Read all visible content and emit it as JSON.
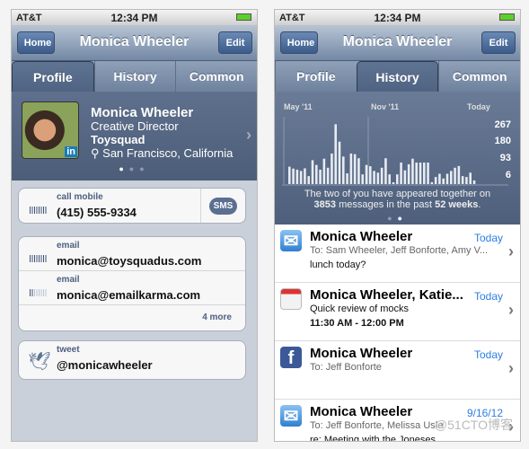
{
  "status": {
    "carrier": "AT&T",
    "time": "12:34 PM"
  },
  "nav": {
    "back": "Home",
    "title": "Monica Wheeler",
    "edit": "Edit"
  },
  "tabs": [
    "Profile",
    "History",
    "Common"
  ],
  "profile": {
    "name": "Monica Wheeler",
    "title": "Creative Director",
    "company": "Toysquad",
    "location": "San Francisco, California",
    "badge": "in"
  },
  "contacts": {
    "phone": {
      "label": "call mobile",
      "value": "(415) 555-9334",
      "sms": "SMS"
    },
    "emails": [
      {
        "label": "email",
        "value": "monica@toysquadus.com"
      },
      {
        "label": "email",
        "value": "monica@emailkarma.com"
      }
    ],
    "more": "4 more",
    "tweet": {
      "label": "tweet",
      "value": "@monicawheeler"
    }
  },
  "chart_data": {
    "type": "bar",
    "x_labels": [
      "May '11",
      "Nov '11",
      "Today"
    ],
    "y_ticks": [
      267,
      180,
      93,
      6
    ],
    "values": [
      81,
      72,
      67,
      61,
      73,
      37,
      111,
      89,
      67,
      118,
      76,
      142,
      278,
      197,
      128,
      50,
      142,
      139,
      120,
      45,
      89,
      83,
      61,
      53,
      76,
      120,
      45,
      6,
      45,
      100,
      64,
      92,
      118,
      100,
      100,
      100,
      100,
      9,
      33,
      48,
      26,
      48,
      61,
      76,
      84,
      37,
      33,
      53,
      17
    ]
  },
  "history": {
    "msg_pre": "The two of you have appeared together on",
    "count": "3853",
    "msg_mid": "messages in the past",
    "period": "52 weeks",
    "msg_end": "."
  },
  "messages": [
    {
      "icon": "mail",
      "title": "Monica Wheeler",
      "date": "Today",
      "line1": "To: Sam Wheeler, Jeff Bonforte, Amy V...",
      "line2": "lunch today?"
    },
    {
      "icon": "calendar",
      "title": "Monica Wheeler, Katie...",
      "date": "Today",
      "line1": "Quick review of mocks",
      "line2": "11:30 AM - 12:00 PM"
    },
    {
      "icon": "facebook",
      "title": "Monica Wheeler",
      "date": "Today",
      "line1": "To: Jeff Bonforte",
      "line2": ""
    },
    {
      "icon": "mail",
      "title": "Monica Wheeler",
      "date": "9/16/12",
      "line1": "To: Jeff Bonforte, Melissa Usle",
      "line2": "re: Meeting with the Joneses"
    }
  ],
  "watermark": "@51CTO博客"
}
